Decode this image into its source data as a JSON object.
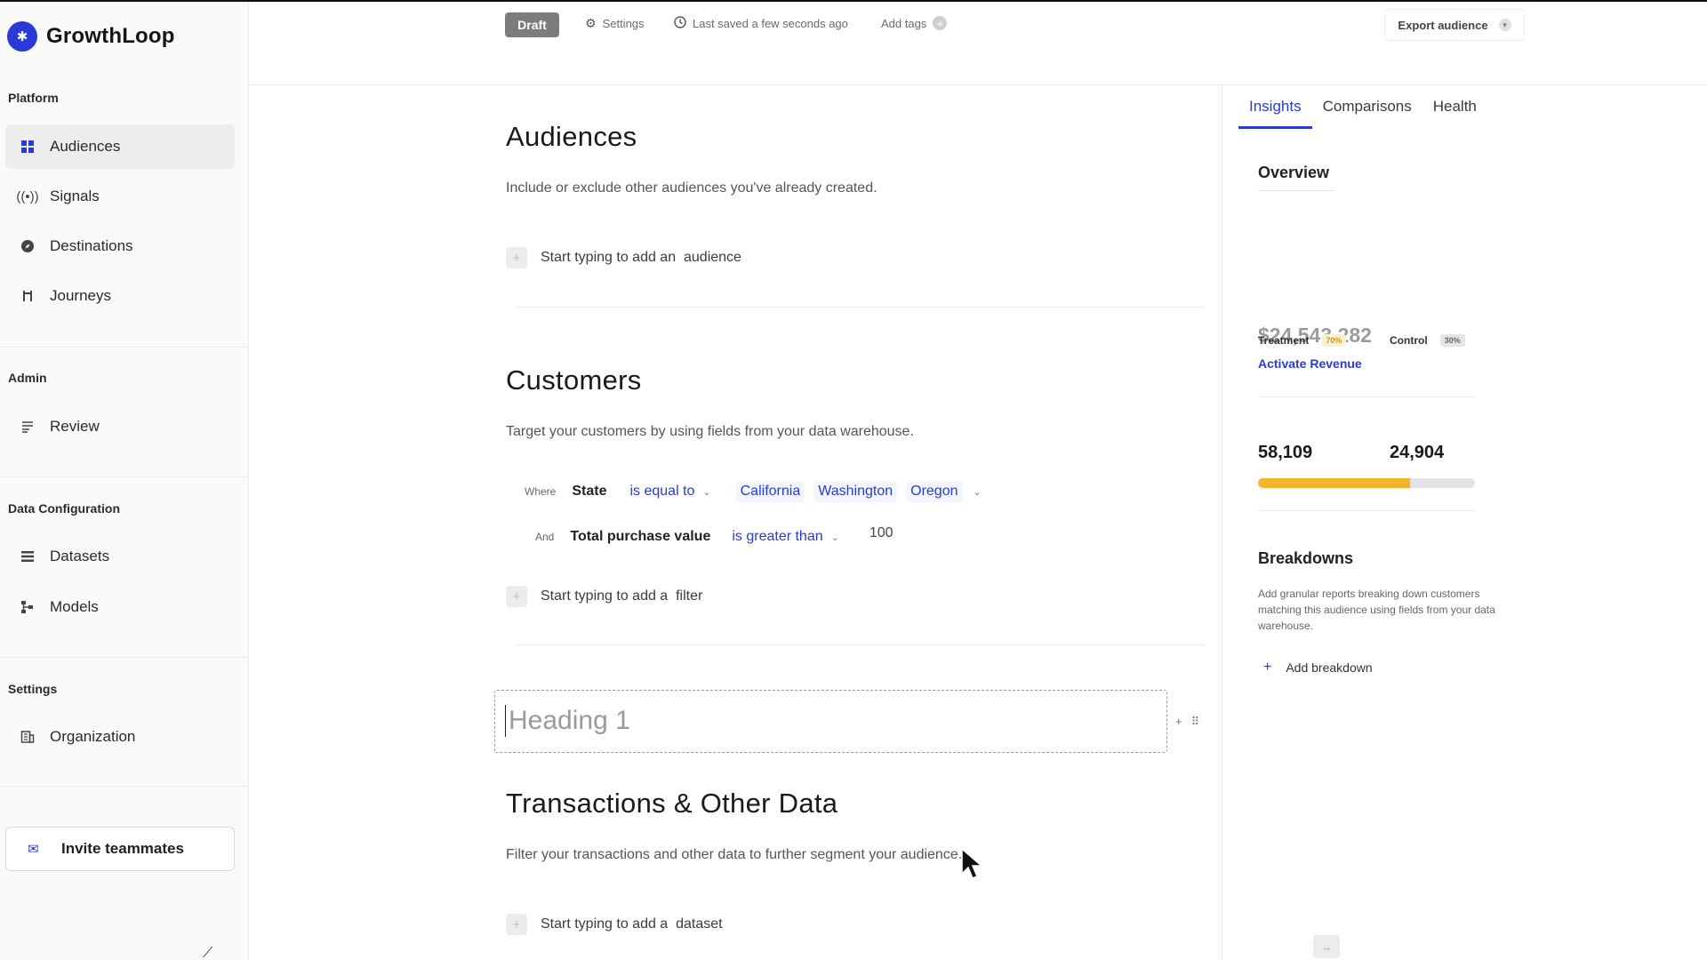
{
  "brand": {
    "name": "GrowthLoop"
  },
  "sidebar": {
    "sections": {
      "platform": "Platform",
      "admin": "Admin",
      "data_configuration": "Data Configuration",
      "settings": "Settings"
    },
    "items": {
      "audiences": "Audiences",
      "signals": "Signals",
      "destinations": "Destinations",
      "journeys": "Journeys",
      "review": "Review",
      "datasets": "Datasets",
      "models": "Models",
      "organization": "Organization"
    },
    "active_item": "Audiences",
    "invite_label": "Invite teammates"
  },
  "topbar": {
    "status": "Draft",
    "settings_label": "Settings",
    "saved_label": "Last saved a few seconds ago",
    "add_tags_label": "Add tags",
    "export_label": "Export audience"
  },
  "main": {
    "audiences": {
      "title": "Audiences",
      "description": "Include or exclude other audiences you've already created.",
      "add_placeholder": "Start typing to add an  audience"
    },
    "customers": {
      "title": "Customers",
      "description": "Target your customers by using fields from your data warehouse.",
      "conditions": [
        {
          "keyword": "Where",
          "field": "State",
          "operator": "is equal to",
          "values": [
            "California",
            "Washington",
            "Oregon"
          ]
        },
        {
          "keyword": "And",
          "field": "Total purchase value",
          "operator": "is greater than",
          "value": "100"
        }
      ],
      "add_placeholder": "Start typing to add a  filter"
    },
    "heading_placeholder": "Heading 1",
    "transactions": {
      "title": "Transactions & Other Data",
      "description": "Filter your transactions and other data to further segment your audience.",
      "add_placeholder": "Start typing to add a  dataset"
    }
  },
  "right_panel": {
    "tabs": [
      "Insights",
      "Comparisons",
      "Health"
    ],
    "active_tab": "Insights",
    "overview": {
      "title": "Overview",
      "revenue": "$24,543,282",
      "activate_link": "Activate Revenue",
      "treatment": {
        "label": "Treatment",
        "percent": "70%",
        "count": "58,109"
      },
      "control": {
        "label": "Control",
        "percent": "30%",
        "count": "24,904"
      },
      "treatment_fraction": 0.7
    },
    "breakdowns": {
      "title": "Breakdowns",
      "description": "Add granular reports breaking down customers matching this audience using fields from your data warehouse.",
      "add_label": "Add breakdown"
    }
  },
  "colors": {
    "accent": "#2a3ad6",
    "treatment_bar": "#f2b62b",
    "draft_badge": "#7c7c7c"
  }
}
